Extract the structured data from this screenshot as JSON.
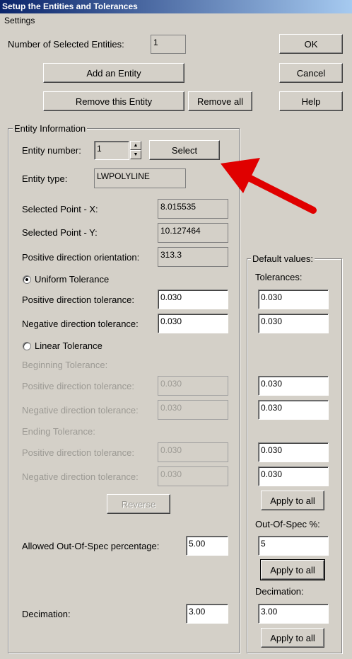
{
  "window": {
    "title": "Setup the Entities and Tolerances"
  },
  "menu": {
    "settings": "Settings"
  },
  "top": {
    "num_selected_label": "Number of Selected Entities:",
    "num_selected_value": "1",
    "ok": "OK",
    "cancel": "Cancel",
    "help": "Help",
    "add_entity": "Add an Entity",
    "remove_entity": "Remove this Entity",
    "remove_all": "Remove all"
  },
  "entity": {
    "group_title": "Entity Information",
    "number_label": "Entity number:",
    "number_value": "1",
    "select": "Select",
    "type_label": "Entity type:",
    "type_value": "LWPOLYLINE",
    "point_x_label": "Selected Point - X:",
    "point_x_value": "8.015535",
    "point_y_label": "Selected Point - Y:",
    "point_y_value": "10.127464",
    "orientation_label": "Positive direction orientation:",
    "orientation_value": "313.3",
    "uniform_label": "Uniform Tolerance",
    "uniform_pos_label": "Positive direction tolerance:",
    "uniform_pos_value": "0.030",
    "uniform_neg_label": "Negative direction tolerance:",
    "uniform_neg_value": "0.030",
    "linear_label": "Linear Tolerance",
    "beginning_label": "Beginning Tolerance:",
    "begin_pos_label": "Positive direction tolerance:",
    "begin_pos_value": "0.030",
    "begin_neg_label": "Negative direction tolerance:",
    "begin_neg_value": "0.030",
    "ending_label": "Ending Tolerance:",
    "end_pos_label": "Positive direction tolerance:",
    "end_pos_value": "0.030",
    "end_neg_label": "Negative direction tolerance:",
    "end_neg_value": "0.030",
    "reverse": "Reverse",
    "oos_label": "Allowed Out-Of-Spec percentage:",
    "oos_value": "5.00",
    "decimation_label": "Decimation:",
    "decimation_value": "3.00"
  },
  "defaults": {
    "group_title": "Default values:",
    "tolerances_label": "Tolerances:",
    "uniform_pos": "0.030",
    "uniform_neg": "0.030",
    "begin_pos": "0.030",
    "begin_neg": "0.030",
    "end_pos": "0.030",
    "end_neg": "0.030",
    "apply_all_1": "Apply to all",
    "oos_label": "Out-Of-Spec %:",
    "oos_value": "5",
    "apply_all_2": "Apply to all",
    "decimation_label": "Decimation:",
    "decimation_value": "3.00",
    "apply_all_3": "Apply to all"
  },
  "colors": {
    "annotation_arrow": "#e00000",
    "titlebar": "#0a246a"
  }
}
